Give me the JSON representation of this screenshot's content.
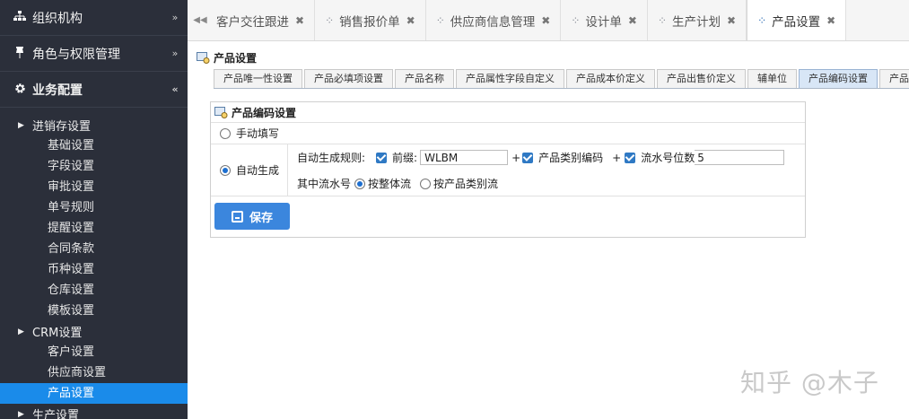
{
  "sidebar": {
    "groups": [
      {
        "label": "组织机构",
        "icon": "org-icon",
        "chevron": "»"
      },
      {
        "label": "角色与权限管理",
        "icon": "pin-icon",
        "chevron": "»"
      },
      {
        "label": "业务配置",
        "icon": "gear-icon",
        "chevron": "«"
      }
    ],
    "sub1": {
      "label": "进销存设置",
      "items": [
        "基础设置",
        "字段设置",
        "审批设置",
        "单号规则",
        "提醒设置",
        "合同条款",
        "币种设置",
        "仓库设置",
        "模板设置"
      ]
    },
    "sub2": {
      "label": "CRM设置",
      "items": [
        "客户设置",
        "供应商设置",
        "产品设置"
      ]
    },
    "sub3": {
      "label": "生产设置"
    }
  },
  "tabs": [
    {
      "label": "客户交往跟进"
    },
    {
      "label": "销售报价单"
    },
    {
      "label": "供应商信息管理"
    },
    {
      "label": "设计单"
    },
    {
      "label": "生产计划"
    },
    {
      "label": "产品设置"
    }
  ],
  "page": {
    "title": "产品设置",
    "subtabs": [
      "产品唯一性设置",
      "产品必填项设置",
      "产品名称",
      "产品属性字段自定义",
      "产品成本价定义",
      "产品出售价定义",
      "辅单位",
      "产品编码设置",
      "产品类"
    ],
    "panel_title": "产品编码设置",
    "manual_label": "手动填写",
    "auto_label": "自动生成",
    "rule_label": "自动生成规则:",
    "prefix_label": "前缀:",
    "prefix_value": "WLBM",
    "plus": "+",
    "category_code_label": "产品类别编码",
    "serial_digits_label": "流水号位数",
    "serial_digits_value": "5",
    "serial_label": "其中流水号",
    "serial_opt1": "按整体流",
    "serial_opt2": "按产品类别流",
    "save_label": "保存"
  },
  "watermark": "知乎 @木子",
  "colors": {
    "accent": "#1a8bea",
    "sidebar_bg": "#2b2f3a",
    "button": "#3b86dd"
  }
}
